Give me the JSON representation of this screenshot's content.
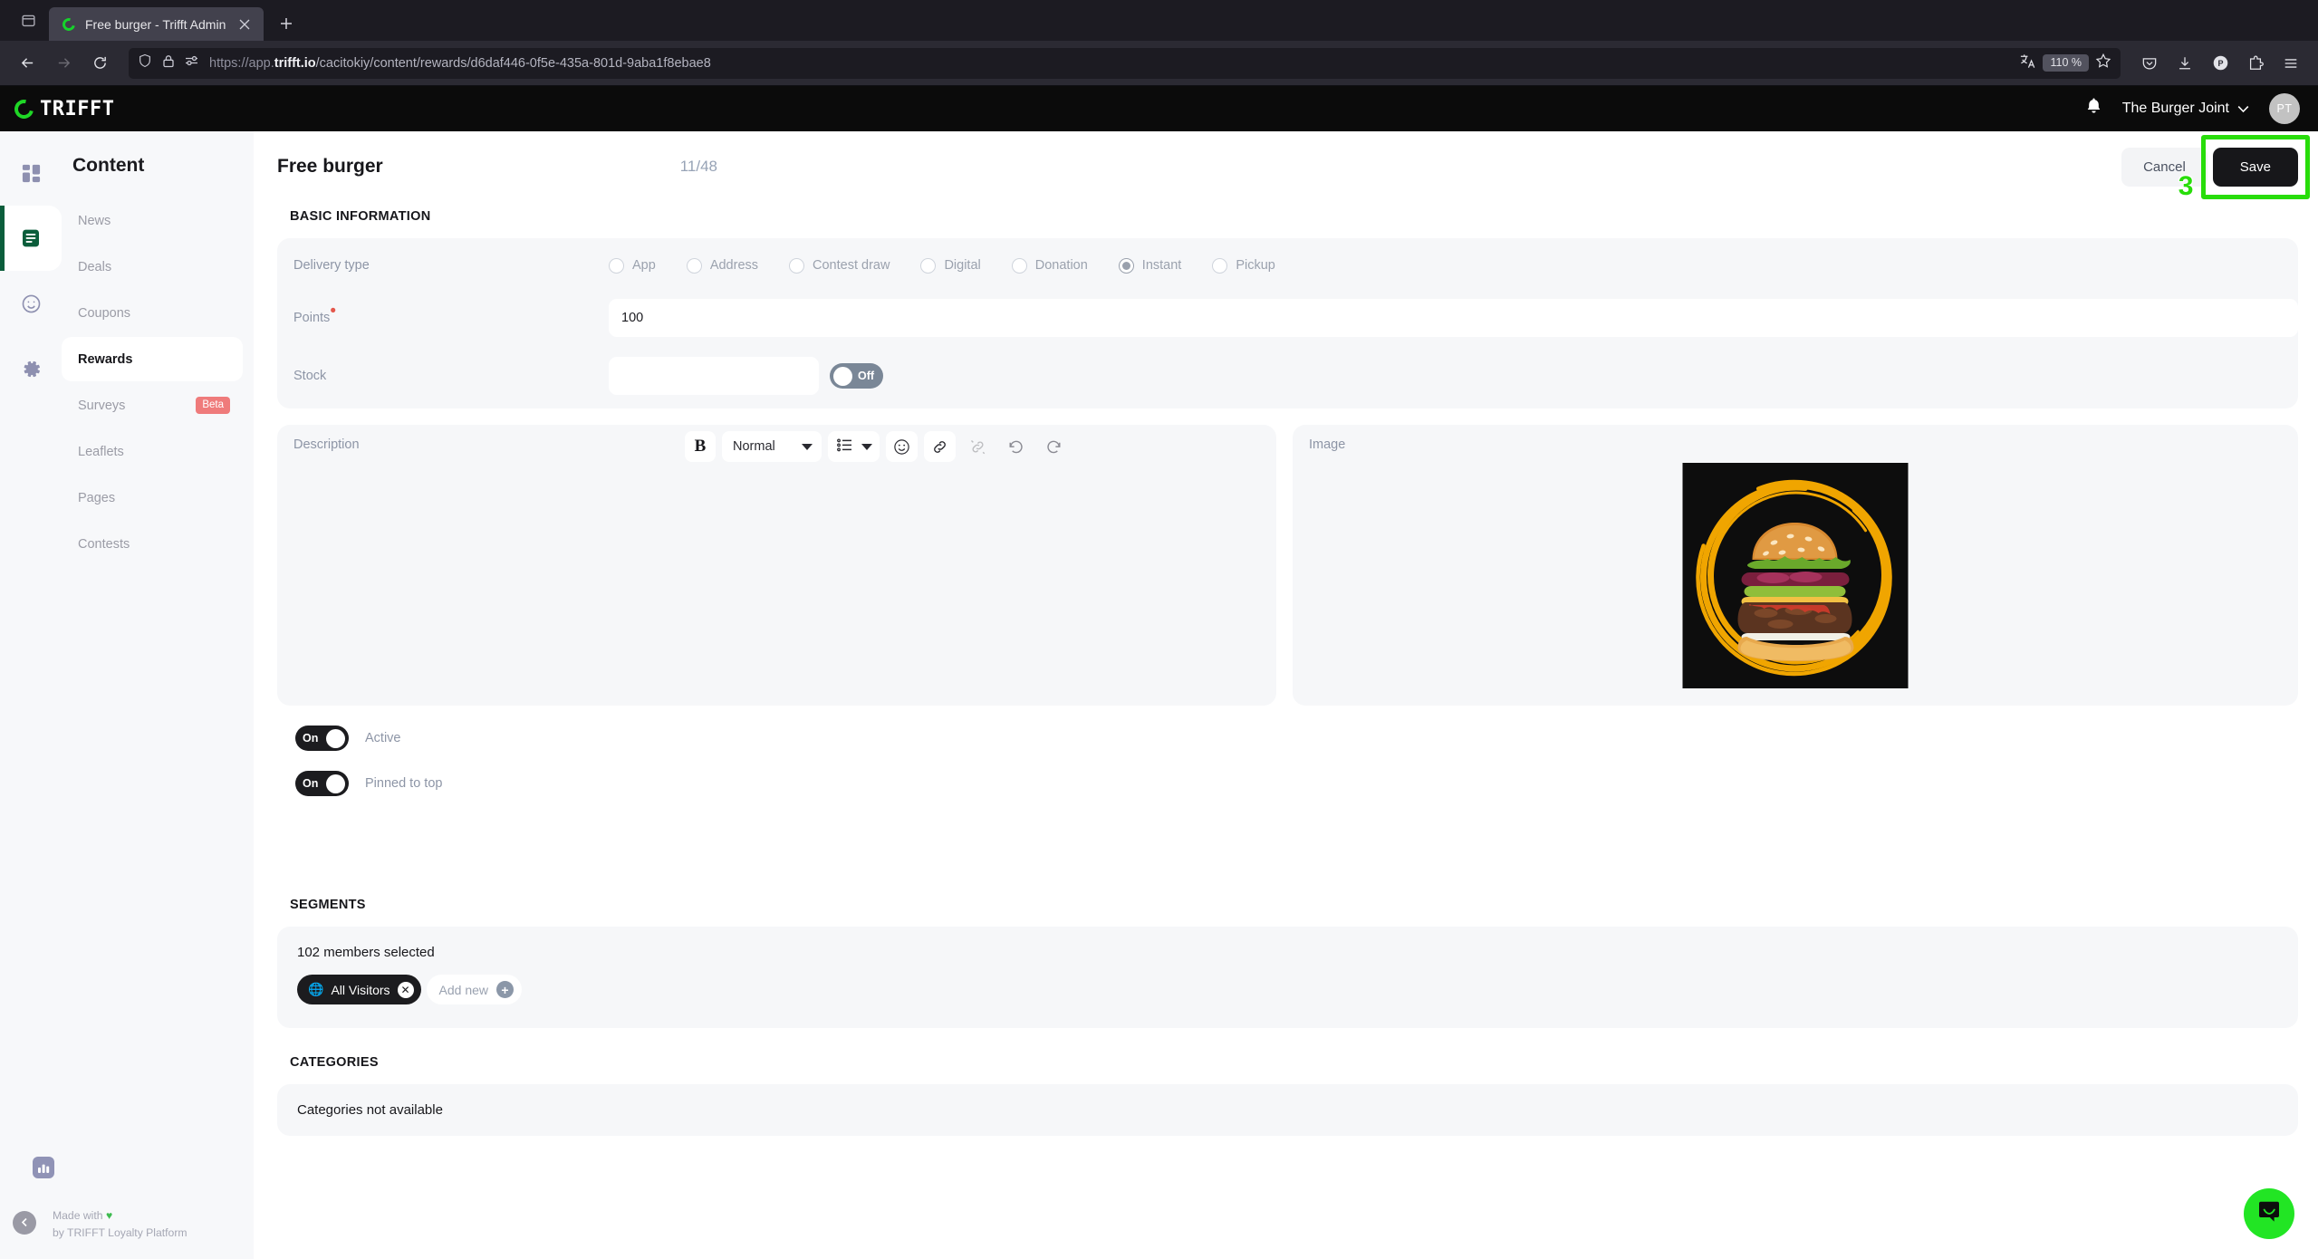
{
  "browser": {
    "tab": {
      "title": "Free burger - Trifft Admin",
      "favicon": "trifft-ring-icon",
      "close": "×"
    },
    "new_tab_label": "+",
    "url": {
      "scheme": "https://app.",
      "domain": "trifft.io",
      "path": "/cacitokiy/content/rewards/d6daf446-0f5e-435a-801d-9aba1f8ebae8"
    },
    "zoom_level": "110 %",
    "icons": [
      "tab-list-icon",
      "back-icon",
      "forward-icon",
      "reload-icon",
      "shield-icon",
      "lock-icon",
      "permissions-icon",
      "translate-icon",
      "bookmark-star-icon",
      "pocket-icon",
      "downloads-icon",
      "profile-icon",
      "extensions-icon",
      "app-menu-icon"
    ],
    "profile_initial": "P"
  },
  "appbar": {
    "logo_text": "TRIFFT",
    "org_name": "The Burger Joint",
    "avatar_initials": "PT"
  },
  "sidebar": {
    "heading": "Content",
    "rail": [
      {
        "name": "dashboard-icon"
      },
      {
        "name": "content-icon",
        "active": true
      },
      {
        "name": "engagement-icon"
      },
      {
        "name": "settings-icon"
      },
      {
        "name": "analytics-icon"
      }
    ],
    "items": [
      {
        "label": "News",
        "active": false
      },
      {
        "label": "Deals",
        "active": false
      },
      {
        "label": "Coupons",
        "active": false
      },
      {
        "label": "Rewards",
        "active": true
      },
      {
        "label": "Surveys",
        "active": false,
        "badge": "Beta"
      },
      {
        "label": "Leaflets",
        "active": false
      },
      {
        "label": "Pages",
        "active": false
      },
      {
        "label": "Contests",
        "active": false
      }
    ],
    "footer": {
      "line1": "Made with",
      "heart": "♥",
      "line2": "by TRIFFT Loyalty Platform"
    }
  },
  "page": {
    "title": "Free burger",
    "counter": "11/48",
    "cancel_label": "Cancel",
    "save_label": "Save",
    "annotation_number": "3",
    "annotation_color": "#28dd0a"
  },
  "basic_information": {
    "section_title": "BASIC INFORMATION",
    "delivery_type": {
      "label": "Delivery type",
      "options": [
        "App",
        "Address",
        "Contest draw",
        "Digital",
        "Donation",
        "Instant",
        "Pickup"
      ],
      "selected": "Instant"
    },
    "points": {
      "label": "Points",
      "required": true,
      "value": "100"
    },
    "stock": {
      "label": "Stock",
      "value": "",
      "toggle_label": "Off",
      "toggle_state": "off"
    }
  },
  "description_panel": {
    "label": "Description",
    "value": "",
    "toolbar": {
      "bold": "B",
      "style_value": "Normal",
      "buttons": [
        "bold-icon",
        "list-icon",
        "emoji-icon",
        "link-icon",
        "unlink-icon",
        "undo-icon",
        "redo-icon"
      ]
    }
  },
  "image_panel": {
    "label": "Image",
    "alt": "burger-thumbnail"
  },
  "switches": [
    {
      "label": "Active",
      "state": "on",
      "state_label": "On"
    },
    {
      "label": "Pinned to top",
      "state": "on",
      "state_label": "On"
    }
  ],
  "segments": {
    "section_title": "SEGMENTS",
    "members_selected": "102 members selected",
    "chips": [
      {
        "label": "All Visitors",
        "icon": "globe-icon",
        "remove": "✕"
      }
    ],
    "add_new_label": "Add new",
    "add_new_icon": "+"
  },
  "categories": {
    "section_title": "CATEGORIES",
    "empty_text": "Categories not available"
  },
  "chat": {
    "icon": "chat-bubble-icon",
    "color": "#22e524"
  }
}
